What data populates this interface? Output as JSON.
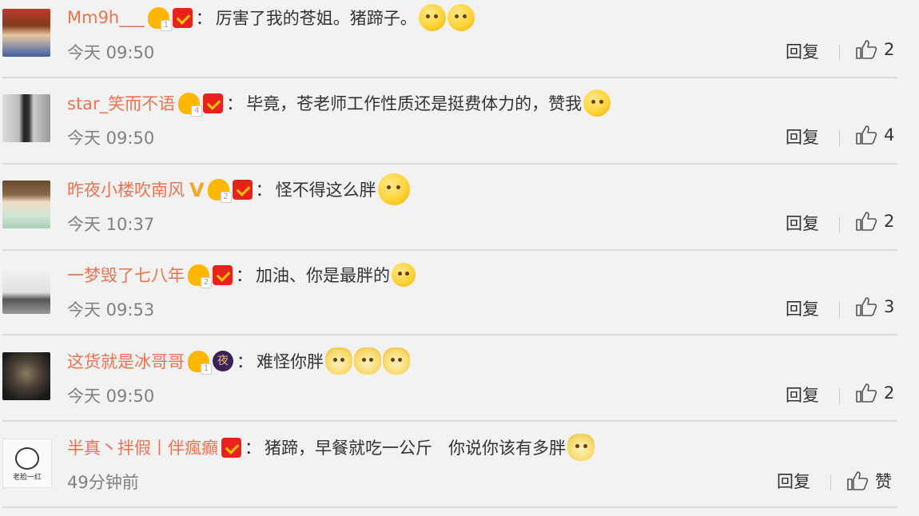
{
  "reply_label": "回复",
  "comments": [
    {
      "user": "Mm9h___",
      "text": "厉害了我的苍姐。猪蹄子。",
      "time": "今天 09:50",
      "likes": "2"
    },
    {
      "user": "star_笑而不语",
      "text": "毕竟，苍老师工作性质还是挺费体力的，赞我",
      "time": "今天 09:50",
      "likes": "4"
    },
    {
      "user": "昨夜小楼吹南风",
      "text": "怪不得这么胖",
      "time": "今天 10:37",
      "likes": "2"
    },
    {
      "user": "一梦毁了七八年",
      "text": "加油、你是最胖的",
      "time": "今天 09:53",
      "likes": "3"
    },
    {
      "user": "这货就是冰哥哥",
      "text": "难怪你胖",
      "time": "今天 09:50",
      "likes": "2"
    },
    {
      "user": "半真丶拌假丨伴瘋癲",
      "text": "猪蹄，早餐就吃一公斤   你说你该有多胖",
      "time": "49分钟前",
      "likes": "赞"
    }
  ],
  "badges": {
    "ye_label": "夜",
    "v_label": "V",
    "avatar6_text": "老脸一红"
  },
  "colors": {
    "username": "#eb7350",
    "background": "#f2f2f2",
    "time": "#808080"
  }
}
